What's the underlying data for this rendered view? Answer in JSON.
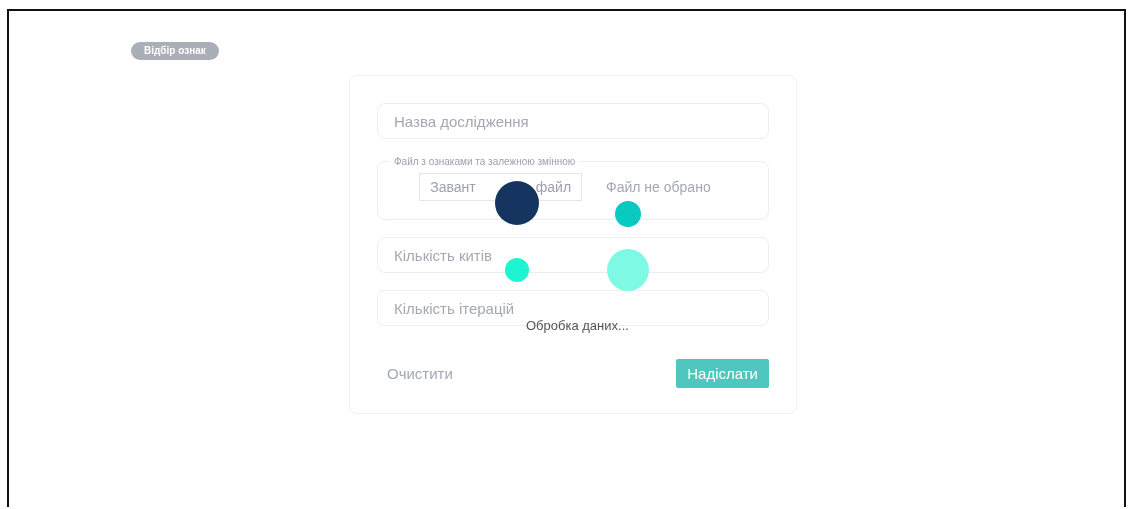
{
  "chip": {
    "label": "Відбір ознак"
  },
  "form": {
    "fields": [
      {
        "placeholder": "Назва дослідження"
      }
    ],
    "file_group": {
      "legend": "Файл з ознаками та залежною змінною",
      "button": [
        "Завант",
        "файл"
      ],
      "status": "Файл не обрано"
    },
    "more_fields": [
      {
        "placeholder": "Кількість китів"
      },
      {
        "placeholder": "Кількість ітерацій"
      }
    ],
    "clear": "Очистити",
    "submit": "Надіслати"
  },
  "loader": {
    "dots": [
      {
        "color": "#15345f"
      },
      {
        "color": "#0ac9c0"
      },
      {
        "color": "#1df5d2"
      },
      {
        "color": "#7ef9e3"
      }
    ],
    "text": "Обробка даних..."
  }
}
